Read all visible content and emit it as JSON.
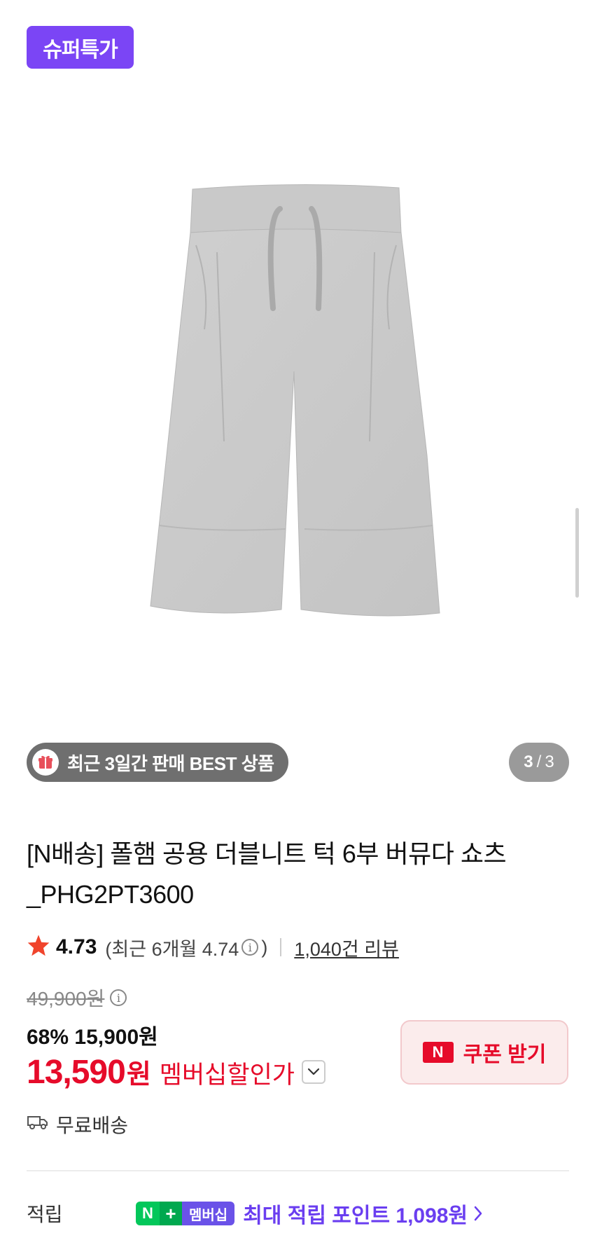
{
  "badge": {
    "label": "슈퍼특가"
  },
  "gallery": {
    "best_label": "최근 3일간 판매 BEST 상품",
    "current": "3",
    "separator": "/",
    "total": "3"
  },
  "product": {
    "title": "[N배송] 폴햄 공용 더블니트 턱 6부 버뮤다 쇼츠 _PHG2PT3600"
  },
  "rating": {
    "score": "4.73",
    "recent_prefix": "(최근 6개월 4.74",
    "recent_suffix": ")",
    "reviews": "1,040건 리뷰"
  },
  "price": {
    "original": "49,900원",
    "sale": "68% 15,900원",
    "member_amount": "13,590",
    "member_unit": "원",
    "member_label": "멤버십할인가"
  },
  "coupon": {
    "label": "쿠폰 받기",
    "logo": "N"
  },
  "shipping": {
    "label": "무료배송"
  },
  "points": {
    "label": "적립",
    "badge_n": "N",
    "badge_plus": "+",
    "badge_member": "멤버십",
    "text": "최대 적립 포인트 1,098원"
  },
  "colors": {
    "accent_purple": "#7b45f5",
    "price_red": "#e60b2a",
    "naver_green": "#03c75a"
  },
  "icons": [
    "gift-icon",
    "star-icon",
    "info-icon",
    "chevron-down-icon",
    "truck-icon",
    "chevron-right-icon"
  ]
}
